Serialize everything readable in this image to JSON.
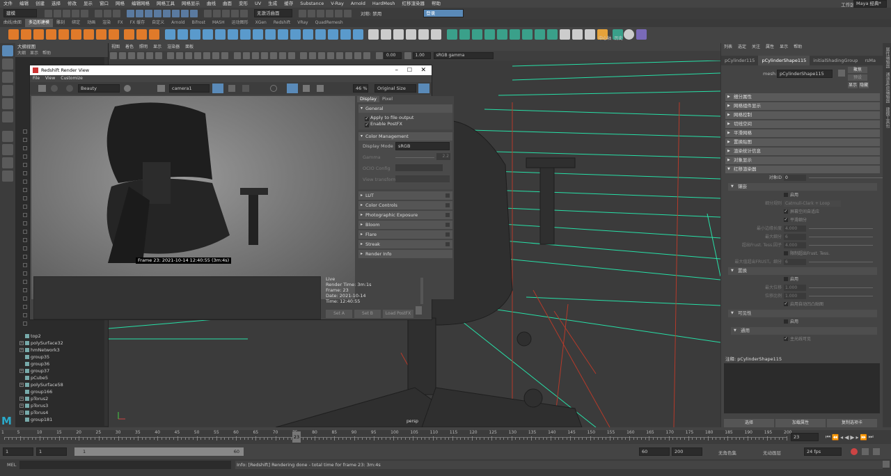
{
  "menubar": [
    "文件",
    "编辑",
    "创建",
    "选择",
    "修改",
    "显示",
    "窗口",
    "网格",
    "编辑网格",
    "网格工具",
    "网格显示",
    "曲线",
    "曲面",
    "变形",
    "UV",
    "生成",
    "缓存",
    "Substance",
    "V-Ray",
    "Arnold",
    "HardMesh",
    "红移渲染器",
    "帮助"
  ],
  "workspace_label": "工作区:",
  "workspace_value": "Maya 经典*",
  "status": {
    "mode": "建模",
    "live": "无激活曲面",
    "symmetry": "对称: 禁用",
    "login": "登录"
  },
  "shelf_tabs": [
    "曲线/曲面",
    "多边形建模",
    "雕刻",
    "绑定",
    "动画",
    "渲染",
    "FX",
    "FX 缓存",
    "自定义",
    "Arnold",
    "Bifrost",
    "MASH",
    "运动图形",
    "XGen",
    "Redshift",
    "VRay",
    "QuadRemesh"
  ],
  "shelf_active": "多边形建模",
  "shelf_right": {
    "center_pivot": "中心轴",
    "history": "历史"
  },
  "outliner": {
    "title": "大纲视图",
    "menu": [
      "大纲",
      "显示",
      "帮助"
    ],
    "items": [
      {
        "n": "top2",
        "ex": false
      },
      {
        "n": "polySurface32",
        "ex": true
      },
      {
        "n": "hmNetwork3",
        "ex": true
      },
      {
        "n": "group35",
        "ex": false
      },
      {
        "n": "group36",
        "ex": false
      },
      {
        "n": "group37",
        "ex": true
      },
      {
        "n": "pCube5",
        "ex": false
      },
      {
        "n": "polySurface58",
        "ex": true
      },
      {
        "n": "group166",
        "ex": false
      },
      {
        "n": "pTorus2",
        "ex": true
      },
      {
        "n": "pTorus3",
        "ex": true
      },
      {
        "n": "pTorus4",
        "ex": true
      },
      {
        "n": "group181",
        "ex": false
      }
    ]
  },
  "viewport": {
    "menu": [
      "视图",
      "着色",
      "照明",
      "显示",
      "渲染器",
      "面板"
    ],
    "camera_label": "persp",
    "field1": "0.00",
    "field2": "1.00",
    "colorspace": "sRGB gamma"
  },
  "render_view": {
    "title": "Redshift Render View",
    "menu": [
      "File",
      "View",
      "Customize"
    ],
    "aov": "Beauty",
    "camera": "camera1",
    "zoom": "46 %",
    "size": "Original Size",
    "caption": "Frame  23:  2021-10-14  12:40:55  (3m:4s)",
    "tabs": [
      "Display",
      "Pixel"
    ],
    "general": "General",
    "apply": "Apply to file output",
    "postfx": "Enable PostFX",
    "cm": "Color Management",
    "display_mode_lbl": "Display Mode",
    "display_mode": "sRGB",
    "gamma_lbl": "Gamma",
    "gamma": "2.2",
    "ocio": "OCIO Config",
    "view_transform": "View transform",
    "sections": [
      "LUT",
      "Color Controls",
      "Photographic Exposure",
      "Bloom",
      "Flare",
      "Streak",
      "Render Info"
    ],
    "info_lines": [
      "Live",
      "Render Time: 3m:1s",
      "Frame: 23",
      "Date: 2021-10-14",
      "Time: 12:40:55"
    ],
    "buttons": [
      "Set A",
      "Set B",
      "Load PostFX"
    ]
  },
  "attr": {
    "menu": [
      "列表",
      "选定",
      "关注",
      "属性",
      "显示",
      "帮助"
    ],
    "tabs": [
      "pCylinder115",
      "pCylinderShape115",
      "initialShadingGroup",
      "rsMa"
    ],
    "mesh_lbl": "mesh:",
    "mesh_val": "pCylinderShape115",
    "focus": "聚焦",
    "preset": "预设",
    "show": "显示",
    "hide": "隐藏",
    "sections": [
      "细分属性",
      "网格组件显示",
      "网格控制",
      "切线空间",
      "平滑网格",
      "置换贴图",
      "渲染统计信息",
      "对象显示"
    ],
    "redshift": "红移渲染器",
    "objid_lbl": "对象ID",
    "objid": "0",
    "tess": "镶嵌",
    "enable": "启用",
    "subdiv_rule_lbl": "细分规则",
    "subdiv_rule": "Catmull-Clark + Loop",
    "screen_adapt": "屏幕空间自适应",
    "smooth_sub": "平滑细分",
    "min_edge_lbl": "最小边缘长度",
    "min_edge": "4.000",
    "max_sub_lbl": "最大细分",
    "max_sub": "6",
    "out_frust_lbl": "超出Frust. Tess.因子",
    "out_frust": "4.000",
    "limit_frust": "限制超出Frust. Tess.",
    "max_out_lbl": "最大值超出FRUST。细分",
    "max_out": "6",
    "disp": "置换",
    "max_disp_lbl": "最大位移",
    "max_disp": "1.000",
    "disp_scale_lbl": "位移比例",
    "disp_scale": "1.000",
    "auto_bump": "启用自动凹凸贴图",
    "vis": "可见性",
    "enable2": "启用",
    "common": "通用",
    "primary": "主光线可见",
    "note_lbl": "注释:",
    "note_val": "pCylinderShape115",
    "bottom_btns": [
      "选择",
      "加载属性",
      "复制选项卡"
    ]
  },
  "right_side": [
    "属性编辑器",
    "通道盒/层编辑器",
    "建模工具包"
  ],
  "timeline": {
    "ticks": [
      "1",
      "5",
      "10",
      "15",
      "20",
      "23",
      "25",
      "30",
      "35",
      "40",
      "45",
      "50",
      "55",
      "60",
      "65",
      "70",
      "75",
      "80",
      "85",
      "90",
      "95",
      "100",
      "105",
      "110",
      "115",
      "120",
      "125",
      "130",
      "135",
      "140",
      "145",
      "150",
      "155",
      "160",
      "165",
      "170",
      "175",
      "180",
      "185",
      "190",
      "195",
      "200"
    ],
    "current": "23",
    "current_field": "23"
  },
  "range": {
    "start": "1",
    "start2": "1",
    "bar_start": "1",
    "bar_end": "60",
    "end": "60",
    "end2": "200",
    "charset": "无角色集",
    "anim_layer": "无动画层",
    "fps": "24 fps"
  },
  "cmd": {
    "label": "MEL",
    "message": "Info:  [Redshift] Rendering done - total time for frame 23: 3m:4s"
  }
}
